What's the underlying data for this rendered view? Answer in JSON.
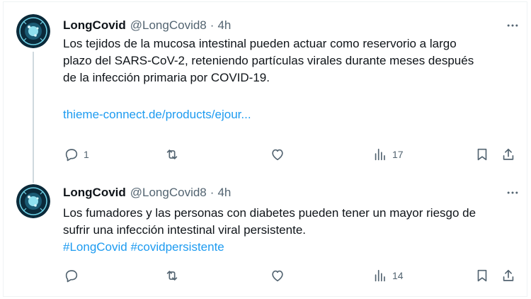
{
  "tweets": [
    {
      "name": "LongCovid",
      "handle": "@LongCovid8",
      "time": "4h",
      "text_lines": [
        "Los tejidos de la mucosa intestinal pueden actuar como reservorio a largo",
        "plazo del SARS-CoV-2, reteniendo partículas virales durante meses después",
        "de la infección primaria por COVID-19."
      ],
      "link": "thieme-connect.de/products/ejour...",
      "replies": "1",
      "retweets": "",
      "likes": "",
      "views": "17"
    },
    {
      "name": "LongCovid",
      "handle": "@LongCovid8",
      "time": "4h",
      "text_lines": [
        "Los fumadores y las personas con diabetes pueden tener un mayor riesgo de",
        "sufrir una infección intestinal viral persistente."
      ],
      "hashtags": "#LongCovid #covidpersistente",
      "replies": "",
      "retweets": "",
      "likes": "",
      "views": "14"
    }
  ],
  "separator": "·",
  "colors": {
    "text": "#0f1419",
    "secondary": "#536471",
    "link": "#1d9bf0",
    "thread_line": "#cfd9de",
    "avatar_bg": "#0b2a3a",
    "avatar_ring": "#6fd3e8"
  },
  "icons": [
    "avatar-logo",
    "more-icon",
    "reply-icon",
    "retweet-icon",
    "like-icon",
    "views-icon",
    "bookmark-icon",
    "share-icon"
  ]
}
